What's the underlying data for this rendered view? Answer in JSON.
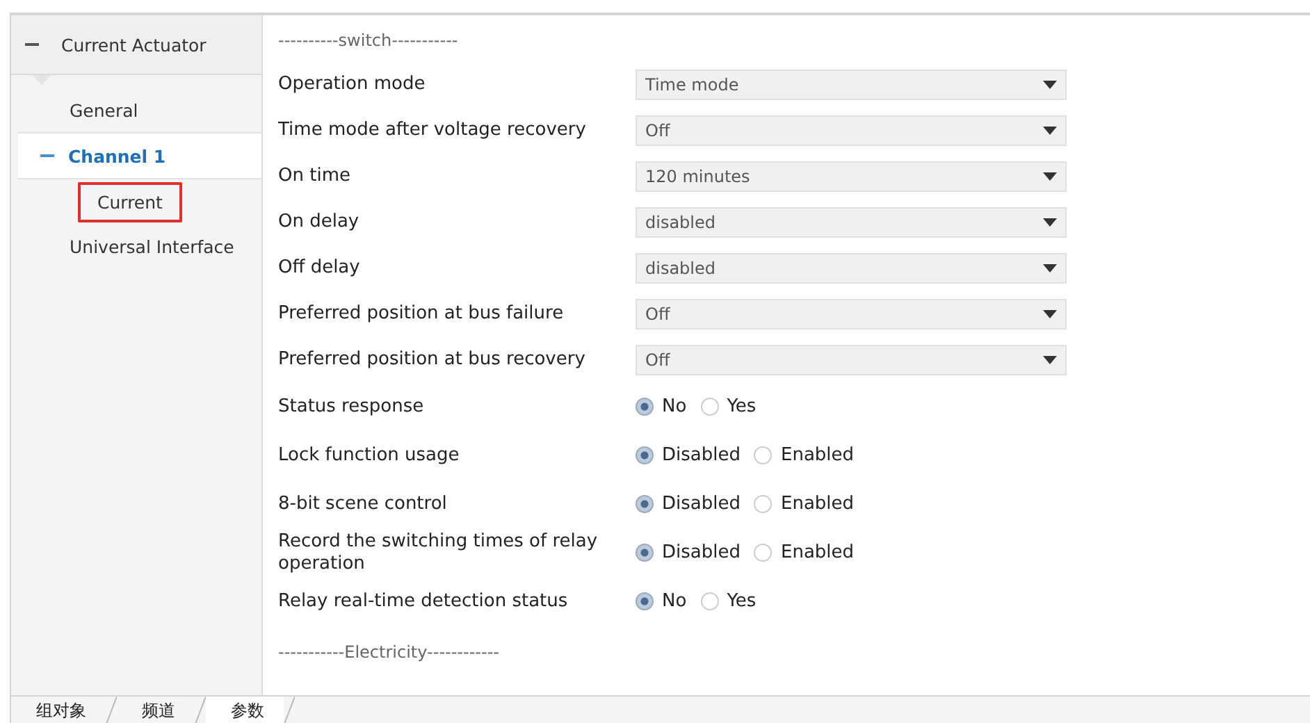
{
  "sidebar": {
    "header": {
      "label": "Current Actuator",
      "expanded": true
    },
    "items": [
      {
        "label": "General",
        "selected": false,
        "highlighted": false
      },
      {
        "label": "Channel 1",
        "selected": true,
        "highlighted": false,
        "expanded": true,
        "children": [
          {
            "label": "Current",
            "selected": false,
            "highlighted": true
          }
        ]
      },
      {
        "label": "Universal Interface",
        "selected": false,
        "highlighted": false
      }
    ]
  },
  "parameters": [
    {
      "kind": "heading",
      "label": "----------switch-----------"
    },
    {
      "kind": "dropdown",
      "label": "Operation mode",
      "value": "Time mode"
    },
    {
      "kind": "dropdown",
      "label": "Time mode after voltage recovery",
      "value": "Off"
    },
    {
      "kind": "dropdown",
      "label": "On time",
      "value": "120 minutes"
    },
    {
      "kind": "dropdown",
      "label": "On delay",
      "value": "disabled"
    },
    {
      "kind": "dropdown",
      "label": "Off delay",
      "value": "disabled"
    },
    {
      "kind": "dropdown",
      "label": "Preferred position at bus failure",
      "value": "Off"
    },
    {
      "kind": "dropdown",
      "label": "Preferred position at bus recovery",
      "value": "Off"
    },
    {
      "kind": "radio",
      "label": "Status response",
      "options": [
        {
          "label": "No",
          "selected": true
        },
        {
          "label": "Yes",
          "selected": false
        }
      ]
    },
    {
      "kind": "radio",
      "label": "Lock function usage",
      "options": [
        {
          "label": "Disabled",
          "selected": true
        },
        {
          "label": "Enabled",
          "selected": false
        }
      ]
    },
    {
      "kind": "radio",
      "label": "8-bit scene control",
      "options": [
        {
          "label": "Disabled",
          "selected": true
        },
        {
          "label": "Enabled",
          "selected": false
        }
      ]
    },
    {
      "kind": "radio",
      "label": "Record the switching times of relay operation",
      "options": [
        {
          "label": "Disabled",
          "selected": true
        },
        {
          "label": "Enabled",
          "selected": false
        }
      ]
    },
    {
      "kind": "radio",
      "label": "Relay real-time detection status",
      "options": [
        {
          "label": "No",
          "selected": true
        },
        {
          "label": "Yes",
          "selected": false
        }
      ]
    },
    {
      "kind": "heading",
      "label": "-----------Electricity------------"
    }
  ],
  "bottom_tabs": [
    {
      "label": "组对象",
      "selected": false
    },
    {
      "label": "频道",
      "selected": false
    },
    {
      "label": "参数",
      "selected": true
    }
  ]
}
